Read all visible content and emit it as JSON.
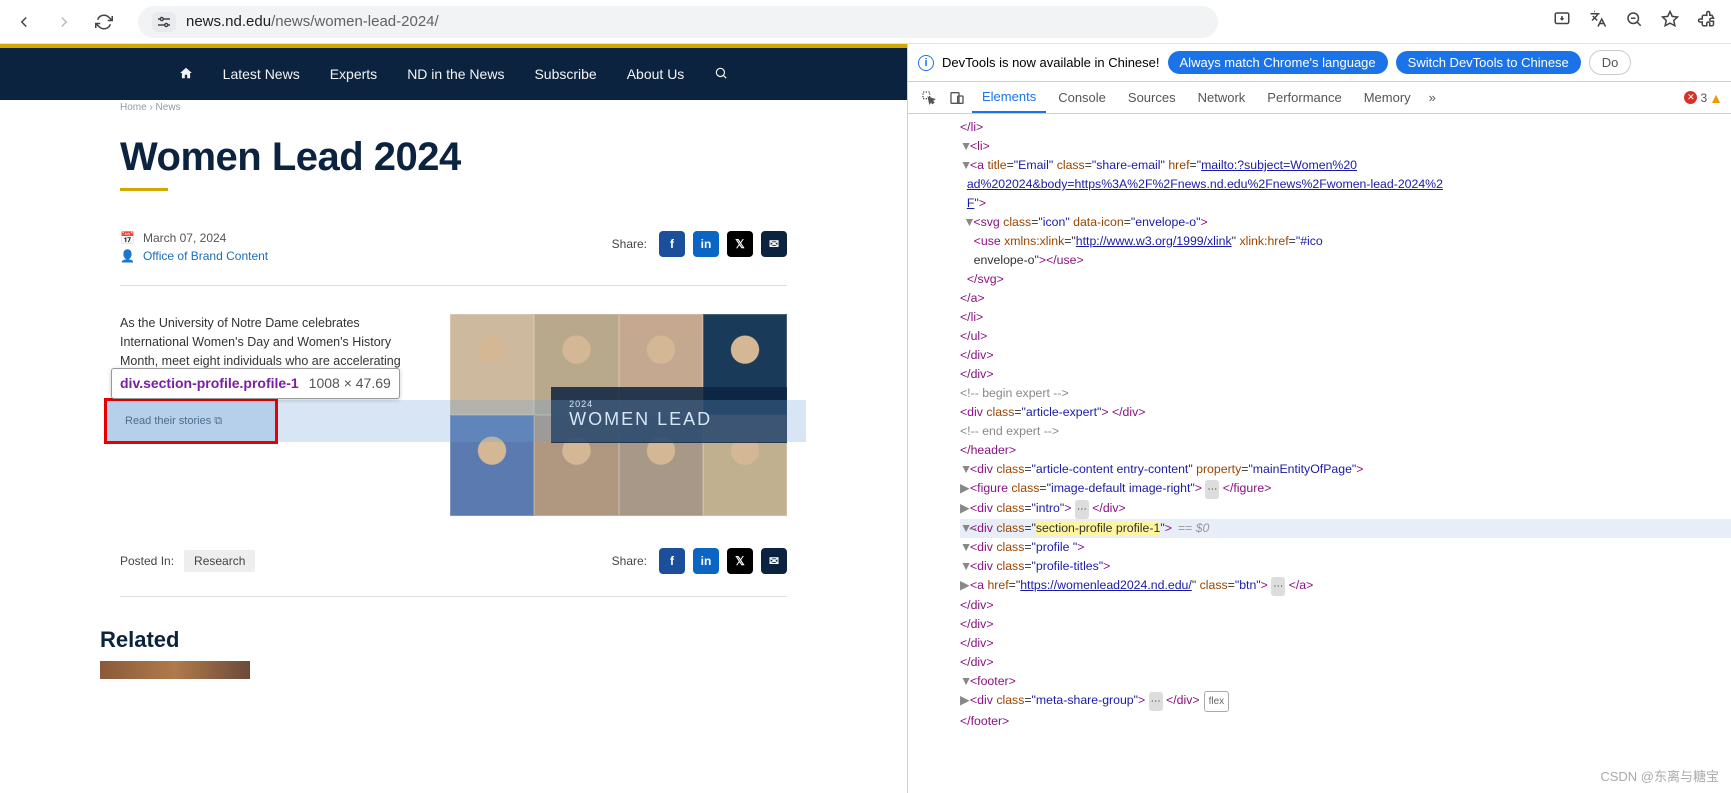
{
  "browser": {
    "url_domain": "news.nd.edu",
    "url_path": "/news/women-lead-2024/"
  },
  "nav": {
    "items": [
      "Latest News",
      "Experts",
      "ND in the News",
      "Subscribe",
      "About Us"
    ],
    "breadcrumb": "Home › News"
  },
  "article": {
    "title": "Women Lead 2024",
    "date": "March 07, 2024",
    "author": "Office of Brand Content",
    "share_label": "Share:",
    "intro": "As the University of Notre Dame celebrates International Women's Day and Women's History Month, meet eight individuals who are accelerating progress in their respective",
    "read_button": "Read their stories",
    "hero_year": "2024",
    "hero_title": "WOMEN LEAD",
    "posted_label": "Posted In:",
    "tag": "Research",
    "related_heading": "Related"
  },
  "inspector_tip": {
    "selector": "div.section-profile.profile-1",
    "dimensions": "1008 × 47.69"
  },
  "devtools": {
    "info_text": "DevTools is now available in Chinese!",
    "pill1": "Always match Chrome's language",
    "pill2": "Switch DevTools to Chinese",
    "pill3": "Do",
    "tabs": [
      "Elements",
      "Console",
      "Sources",
      "Network",
      "Performance",
      "Memory"
    ],
    "error_count": "3",
    "selected_measure": "== $0",
    "dom_lines": [
      {
        "indent": 7,
        "html": "<span class='t'>&lt;/li&gt;</span>"
      },
      {
        "indent": 6,
        "html": "<span class='tw'>▼</span><span class='t'>&lt;li&gt;</span>"
      },
      {
        "indent": 7,
        "html": "<span class='tw'>▼</span><span class='t'>&lt;a</span> <span class='a'>title</span>=<span class='v'>\"Email\"</span> <span class='a'>class</span>=<span class='v'>\"share-email\"</span> <span class='a'>href</span>=\"<span class='lk'>mailto:?subject=Women%20</span>"
      },
      {
        "indent": 7,
        "html": "&nbsp;&nbsp;<span class='lk'>ad%202024&amp;body=https%3A%2F%2Fnews.nd.edu%2Fnews%2Fwomen-lead-2024%2</span>"
      },
      {
        "indent": 7,
        "html": "&nbsp;&nbsp;<span class='lk'>F</span>\"<span class='t'>&gt;</span>"
      },
      {
        "indent": 7,
        "html": "&nbsp;<span class='tw'>▼</span><span class='t'>&lt;svg</span> <span class='a'>class</span>=<span class='v'>\"icon\"</span> <span class='a'>data-icon</span>=<span class='v'>\"envelope-o\"</span><span class='t'>&gt;</span>"
      },
      {
        "indent": 7,
        "html": "&nbsp;&nbsp;&nbsp;&nbsp;<span class='t'>&lt;use</span> <span class='a'>xmlns:xlink</span>=\"<span class='lk'>http://www.w3.org/1999/xlink</span>\" <span class='a'>xlink:href</span>=<span class='v'>\"#ico</span>"
      },
      {
        "indent": 7,
        "html": "&nbsp;&nbsp;&nbsp;&nbsp;envelope-o\"<span class='t'>&gt;&lt;/use&gt;</span>"
      },
      {
        "indent": 7,
        "html": "&nbsp;&nbsp;<span class='t'>&lt;/svg&gt;</span>"
      },
      {
        "indent": 7,
        "html": "<span class='t'>&lt;/a&gt;</span>"
      },
      {
        "indent": 6,
        "html": "<span class='t'>&lt;/li&gt;</span>"
      },
      {
        "indent": 5,
        "html": "<span class='t'>&lt;/ul&gt;</span>"
      },
      {
        "indent": 4,
        "html": "<span class='t'>&lt;/div&gt;</span>"
      },
      {
        "indent": 3,
        "html": "<span class='t'>&lt;/div&gt;</span>"
      },
      {
        "indent": 3,
        "html": "<span class='c'>&lt;!-- begin expert --&gt;</span>"
      },
      {
        "indent": 3,
        "html": "<span class='t'>&lt;div</span> <span class='a'>class</span>=<span class='v'>\"article-expert\"</span><span class='t'>&gt; &lt;/div&gt;</span>"
      },
      {
        "indent": 3,
        "html": "<span class='c'>&lt;!-- end expert --&gt;</span>"
      },
      {
        "indent": 2,
        "html": "<span class='t'>&lt;/header&gt;</span>"
      },
      {
        "indent": 2,
        "html": "<span class='tw'>▼</span><span class='t'>&lt;div</span> <span class='a'>class</span>=<span class='v'>\"article-content entry-content\"</span> <span class='a'>property</span>=<span class='v'>\"mainEntityOfPage\"</span><span class='t'>&gt;</span>"
      },
      {
        "indent": 3,
        "html": "<span class='tw'>▶</span><span class='t'>&lt;figure</span> <span class='a'>class</span>=<span class='v'>\"image-default image-right\"</span><span class='t'>&gt;</span> <span class='ellipsis-badge'>⋯</span> <span class='t'>&lt;/figure&gt;</span>"
      },
      {
        "indent": 3,
        "html": "<span class='tw'>▶</span><span class='t'>&lt;div</span> <span class='a'>class</span>=<span class='v'>\"intro\"</span><span class='t'>&gt;</span> <span class='ellipsis-badge'>⋯</span> <span class='t'>&lt;/div&gt;</span>"
      },
      {
        "indent": 3,
        "html": "<span class='tw'>▼</span><span class='t'>&lt;div</span> <span class='a'>class</span>=\"<span class='hl'>section-profile profile-1</span>\"<span class='t'>&gt;</span><span class='meas'>== $0</span>",
        "sel": true,
        "gutter": true
      },
      {
        "indent": 4,
        "html": "<span class='tw'>▼</span><span class='t'>&lt;div</span> <span class='a'>class</span>=<span class='v'>\"profile \"</span><span class='t'>&gt;</span>"
      },
      {
        "indent": 5,
        "html": "<span class='tw'>▼</span><span class='t'>&lt;div</span> <span class='a'>class</span>=<span class='v'>\"profile-titles\"</span><span class='t'>&gt;</span>"
      },
      {
        "indent": 6,
        "html": "<span class='tw'>▶</span><span class='t'>&lt;a</span> <span class='a'>href</span>=\"<span class='lk'>https://womenlead2024.nd.edu/</span>\" <span class='a'>class</span>=<span class='v'>\"btn\"</span><span class='t'>&gt;</span> <span class='ellipsis-badge'>⋯</span> <span class='t'>&lt;/a&gt;</span>"
      },
      {
        "indent": 5,
        "html": "<span class='t'>&lt;/div&gt;</span>"
      },
      {
        "indent": 4,
        "html": "<span class='t'>&lt;/div&gt;</span>"
      },
      {
        "indent": 3,
        "html": "<span class='t'>&lt;/div&gt;</span>"
      },
      {
        "indent": 2,
        "html": "<span class='t'>&lt;/div&gt;</span>"
      },
      {
        "indent": 2,
        "html": "<span class='tw'>▼</span><span class='t'>&lt;footer&gt;</span>"
      },
      {
        "indent": 3,
        "html": "<span class='tw'>▶</span><span class='t'>&lt;div</span> <span class='a'>class</span>=<span class='v'>\"meta-share-group\"</span><span class='t'>&gt;</span> <span class='ellipsis-badge'>⋯</span> <span class='t'>&lt;/div&gt;</span><span class='flex-badge'>flex</span>"
      },
      {
        "indent": 2,
        "html": "<span class='t'>&lt;/footer&gt;</span>"
      }
    ]
  },
  "watermark": "CSDN @东离与糖宝"
}
